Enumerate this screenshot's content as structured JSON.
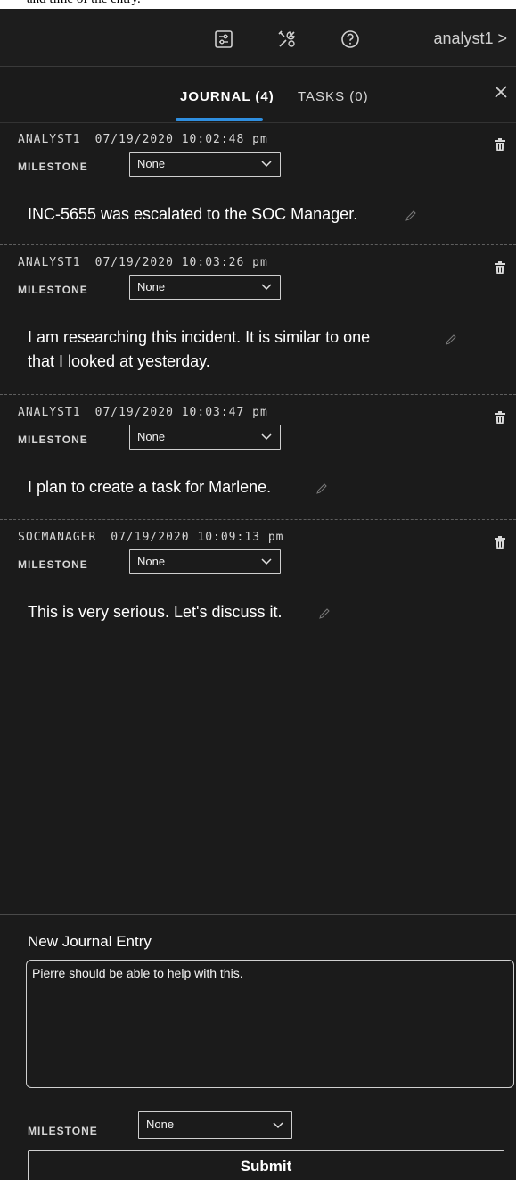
{
  "caption_fragment": "and time of the entry.",
  "topbar": {
    "icons": [
      "settings-panel-icon",
      "tools-icon",
      "help-icon"
    ],
    "user_label": "analyst1 >"
  },
  "tabs": [
    {
      "label": "JOURNAL (4)",
      "active": true
    },
    {
      "label": "TASKS (0)",
      "active": false
    }
  ],
  "milestone_label": "MILESTONE",
  "entries": [
    {
      "author": "ANALYST1",
      "timestamp": "07/19/2020 10:02:48 pm",
      "milestone": "None",
      "text_lines": [
        "INC-5655 was escalated to the SOC Manager."
      ]
    },
    {
      "author": "ANALYST1",
      "timestamp": "07/19/2020 10:03:26 pm",
      "milestone": "None",
      "text_lines": [
        "I am  researching this incident. It is similar to one",
        "that I looked at yesterday."
      ]
    },
    {
      "author": "ANALYST1",
      "timestamp": "07/19/2020 10:03:47 pm",
      "milestone": "None",
      "text_lines": [
        "I plan to create a task for Marlene."
      ]
    },
    {
      "author": "SOCMANAGER",
      "timestamp": "07/19/2020 10:09:13 pm",
      "milestone": "None",
      "text_lines": [
        "This is very serious. Let's discuss it."
      ]
    }
  ],
  "composer": {
    "title": "New Journal Entry",
    "text": "Pierre should be able to help with this.",
    "milestone": "None",
    "submit_label": "Submit"
  },
  "colors": {
    "background": "#1b1b1b",
    "accent": "#2f8fe0",
    "text": "#ffffff"
  }
}
